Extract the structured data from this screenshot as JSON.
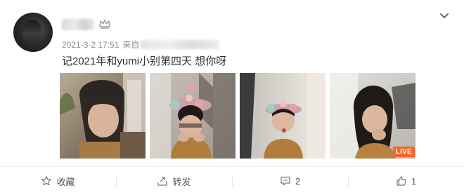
{
  "post": {
    "timestamp": "2021-3-2 17:51",
    "source_prefix": "来自",
    "text": "记2021年和yumi小别第四天 想你呀"
  },
  "photos": [
    {
      "alt": "photo-1"
    },
    {
      "alt": "photo-2"
    },
    {
      "alt": "photo-3"
    },
    {
      "alt": "photo-4",
      "badge": "LIVE"
    }
  ],
  "actions": {
    "favorite_label": "收藏",
    "repost_label": "转发",
    "comment_count": "2",
    "like_count": "1"
  },
  "colors": {
    "live_badge": "#f5682a",
    "meta_text": "#8c8c8c",
    "body_text": "#333333"
  },
  "icons": [
    "star-icon",
    "repost-icon",
    "comment-icon",
    "thumbs-up-icon",
    "chevron-down-icon",
    "crown-icon"
  ]
}
